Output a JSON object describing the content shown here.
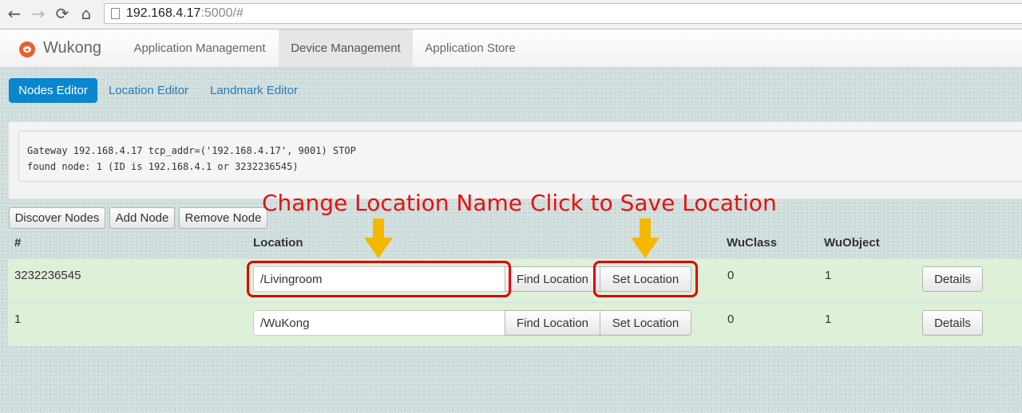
{
  "browser": {
    "url_host": "192.168.4.17",
    "url_rest": ":5000/#",
    "back_icon": "←",
    "forward_icon": "→",
    "reload_icon": "⟳",
    "home_icon": "⌂"
  },
  "navbar": {
    "brand": "Wukong",
    "items": [
      {
        "label": "Application Management",
        "active": false
      },
      {
        "label": "Device Management",
        "active": true
      },
      {
        "label": "Application Store",
        "active": false
      }
    ]
  },
  "subnav": {
    "pills": [
      {
        "label": "Nodes Editor",
        "active": true
      },
      {
        "label": "Location Editor",
        "active": false
      },
      {
        "label": "Landmark Editor",
        "active": false
      }
    ]
  },
  "log": {
    "lines": [
      "Gateway 192.168.4.17 tcp_addr=('192.168.4.17', 9001) STOP",
      "found node: 1 (ID is 192.168.4.1 or 3232236545)"
    ]
  },
  "actions": {
    "discover": "Discover Nodes",
    "add": "Add Node",
    "remove": "Remove Node"
  },
  "table": {
    "headers": {
      "id": "#",
      "location": "Location",
      "wuclass": "WuClass",
      "wuobject": "WuObject"
    },
    "rows": [
      {
        "id": "3232236545",
        "location": "/Livingroom",
        "find": "Find Location",
        "set": "Set Location",
        "wuclass": "0",
        "wuobject": "1",
        "details": "Details"
      },
      {
        "id": "1",
        "location": "/WuKong",
        "find": "Find Location",
        "set": "Set Location",
        "wuclass": "0",
        "wuobject": "1",
        "details": "Details"
      }
    ]
  },
  "annotations": {
    "change_location": "Change Location Name",
    "save_location": "Click to Save Location",
    "text_color": "#e8100e",
    "arrow_color": "#f5b800",
    "box_color": "#e00000"
  }
}
